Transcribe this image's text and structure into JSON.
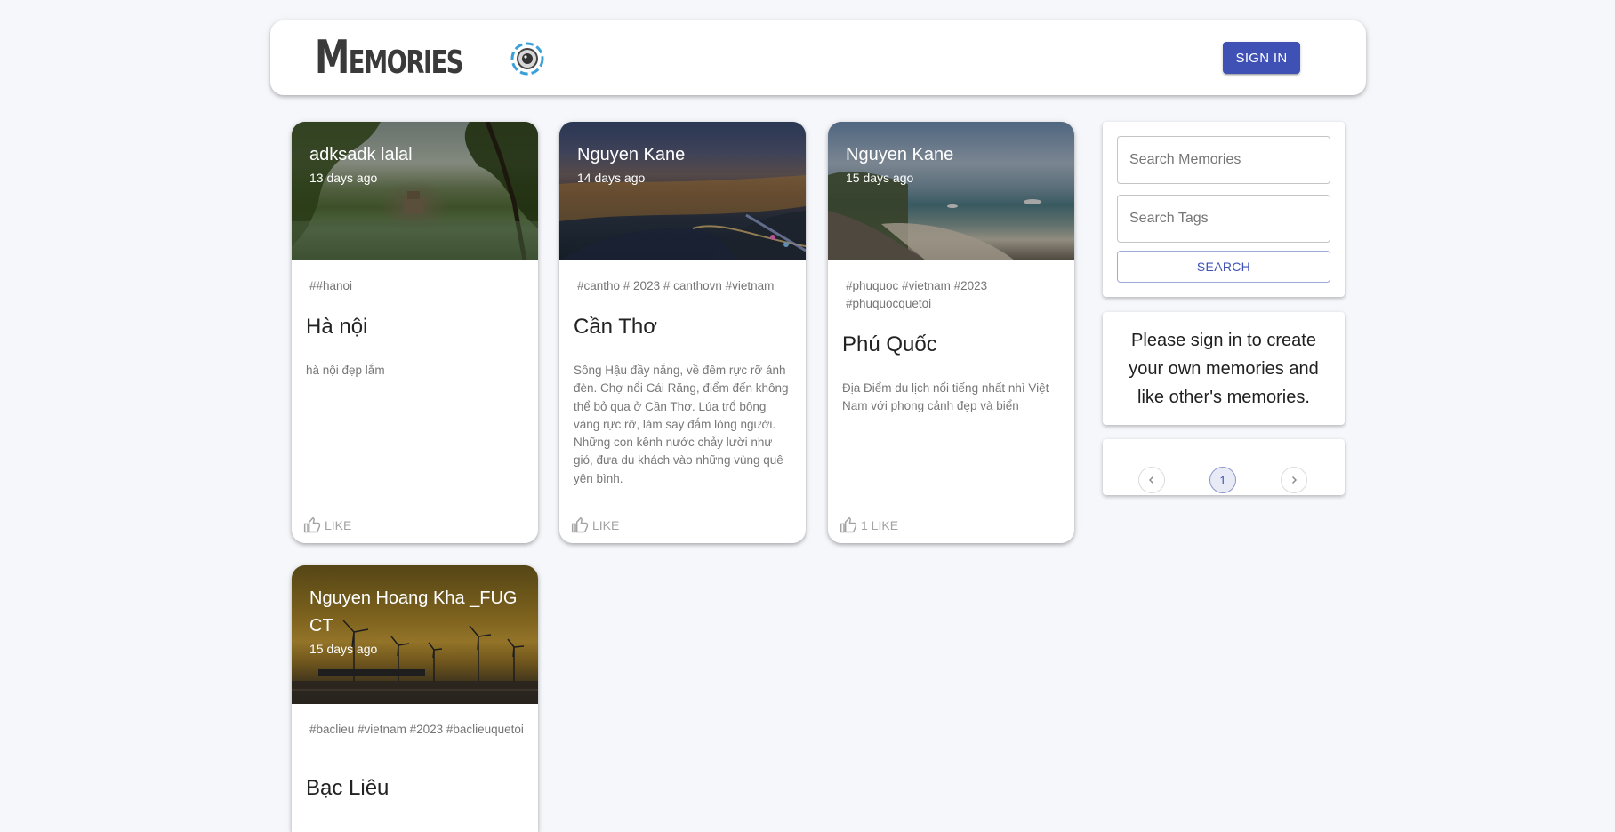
{
  "header": {
    "brand": "Memories",
    "signin_label": "SIGN IN",
    "logo_icon": "camera-lens-icon",
    "accent": "#3f51b5"
  },
  "posts": [
    {
      "author": "adksadk lalal",
      "date": "13 days ago",
      "tags": "##hanoi",
      "title": "Hà nội",
      "message": "hà nội đẹp lắm",
      "like": "LIKE"
    },
    {
      "author": "Nguyen Kane",
      "date": "14 days ago",
      "tags": "#cantho # 2023 # canthovn #vietnam",
      "title": "Cần Thơ",
      "message": "Sông Hậu đầy nắng, về đêm rực rỡ ánh đèn. Chợ nổi Cái Răng, điểm đến không thể bỏ qua ở Cần Thơ. Lúa trổ bông vàng rực rỡ, làm say đắm lòng người. Những con kênh nước chảy lười như gió, đưa du khách vào những vùng quê yên bình.",
      "like": "LIKE"
    },
    {
      "author": "Nguyen Kane",
      "date": "15 days ago",
      "tags": "#phuquoc #vietnam #2023 #phuquocquetoi",
      "title": "Phú Quốc",
      "message": "Địa Điểm du lịch nổi tiếng nhất nhì Việt Nam với phong cảnh đẹp và biển",
      "like": "1 LIKE"
    },
    {
      "author": "Nguyen Hoang Kha _FUG CT",
      "date": "15 days ago",
      "tags": "#baclieu #vietnam #2023 #baclieuquetoi",
      "title": "Bạc Liêu"
    }
  ],
  "search": {
    "memories_placeholder": "Search Memories",
    "tags_placeholder": "Search Tags",
    "button_label": "SEARCH"
  },
  "notice": "Please sign in to create your own memories and like other's memories.",
  "pagination": {
    "current_page": "1",
    "prev_icon": "chevron-left-icon",
    "next_icon": "chevron-right-icon"
  }
}
